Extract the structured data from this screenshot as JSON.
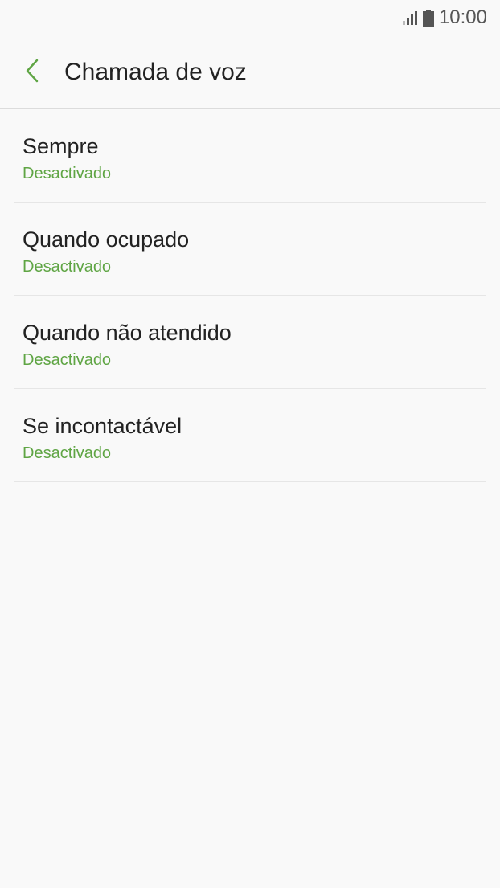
{
  "status_bar": {
    "time": "10:00",
    "icons": [
      "signal-icon",
      "battery-icon"
    ]
  },
  "header": {
    "title": "Chamada de voz",
    "back_icon": "chevron-left-icon"
  },
  "colors": {
    "accent": "#5fa544",
    "text": "#222222",
    "background": "#f9f9f9",
    "divider": "#e6e6e6"
  },
  "list": {
    "items": [
      {
        "title": "Sempre",
        "status": "Desactivado"
      },
      {
        "title": "Quando ocupado",
        "status": "Desactivado"
      },
      {
        "title": "Quando não atendido",
        "status": "Desactivado"
      },
      {
        "title": "Se incontactável",
        "status": "Desactivado"
      }
    ]
  }
}
